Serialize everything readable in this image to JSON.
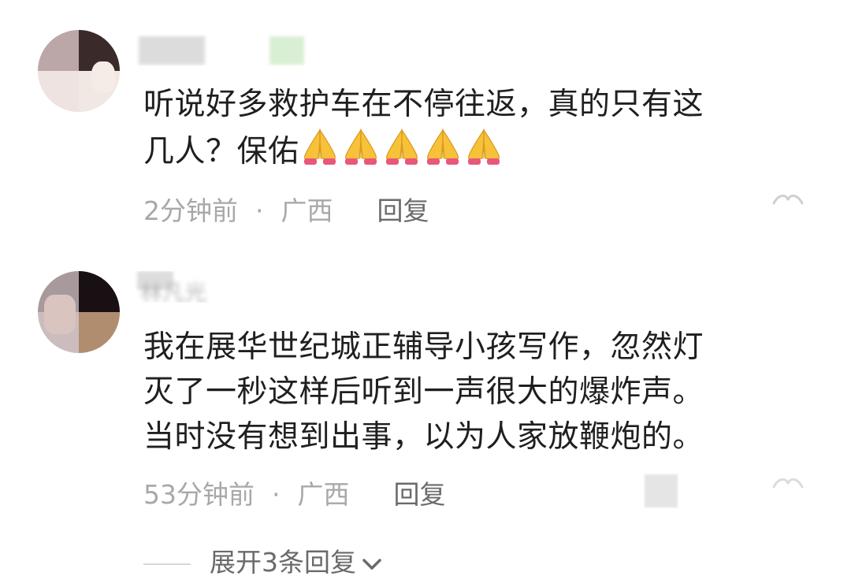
{
  "comments": [
    {
      "text_line1": "听说好多救护车在不停往返，真的只有这",
      "text_line2": "几人？保佑",
      "emoji": "folded-hands-emoji",
      "emoji_count": 5,
      "time": "2分钟前",
      "separator": "·",
      "location": "广西",
      "reply_label": "回复"
    },
    {
      "username_partial": "林凡光",
      "text_line1": "我在展华世纪城正辅导小孩写作，忽然灯",
      "text_line2": "灭了一秒这样后听到一声很大的爆炸声。",
      "text_line3": "当时没有想到出事，以为人家放鞭炮的。",
      "time": "53分钟前",
      "separator": "·",
      "location": "广西",
      "reply_label": "回复"
    }
  ],
  "expand_replies": {
    "label": "展开3条回复",
    "icon": "chevron-down-icon"
  },
  "colors": {
    "text": "#1f1f1f",
    "meta": "#a8a8a8",
    "reply": "#6a6a6a",
    "emoji_yellow": "#f7c23a",
    "emoji_cuff": "#e9577a"
  }
}
